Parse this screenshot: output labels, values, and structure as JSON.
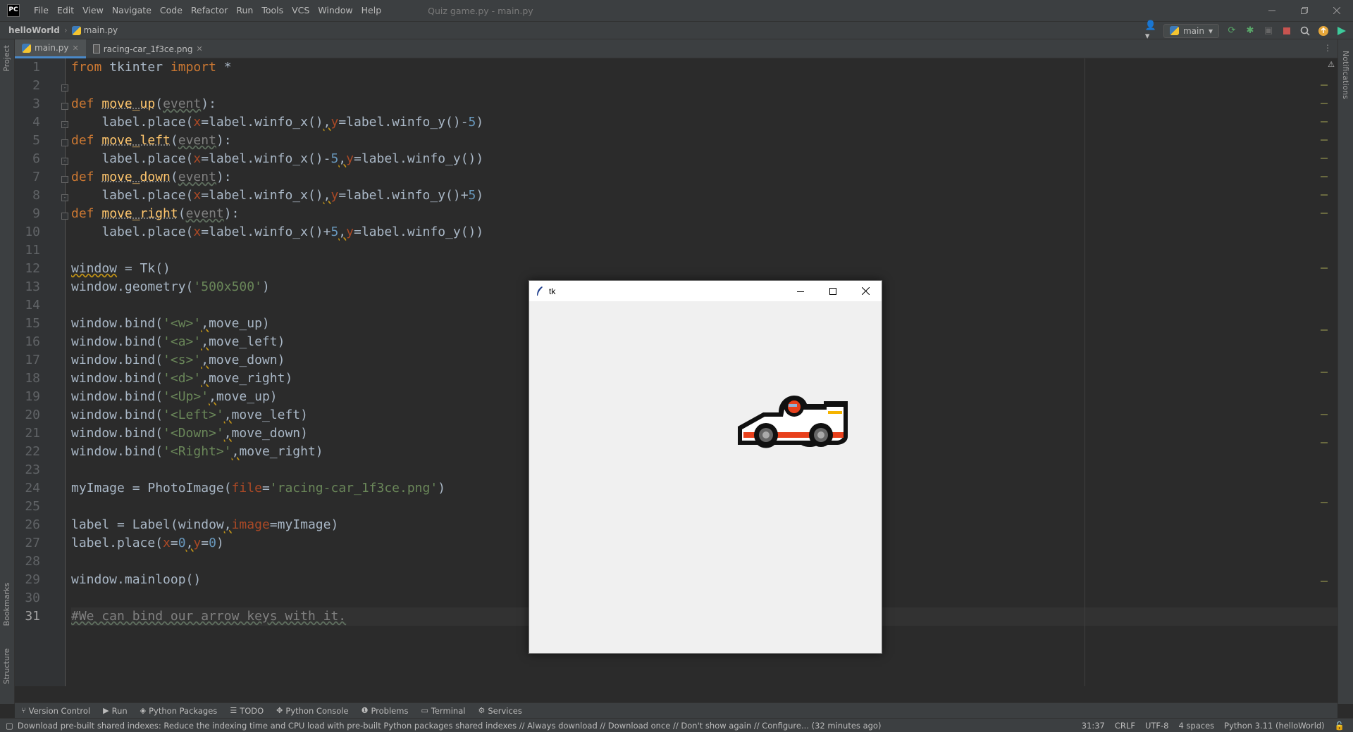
{
  "app": {
    "logo_text": "PC",
    "window_title": "Quiz game.py - main.py"
  },
  "menu": [
    "File",
    "Edit",
    "View",
    "Navigate",
    "Code",
    "Refactor",
    "Run",
    "Tools",
    "VCS",
    "Window",
    "Help"
  ],
  "breadcrumb": {
    "project": "helloWorld",
    "file": "main.py"
  },
  "toolbar": {
    "run_config": "main"
  },
  "tabs": [
    {
      "label": "main.py",
      "active": true
    },
    {
      "label": "racing-car_1f3ce.png",
      "active": false
    }
  ],
  "side_tabs": {
    "project": "Project",
    "bookmarks": "Bookmarks",
    "structure": "Structure",
    "notifications": "Notifications"
  },
  "editor": {
    "current_line": 31,
    "line_numbers": [
      "1",
      "2",
      "3",
      "4",
      "5",
      "6",
      "7",
      "8",
      "9",
      "10",
      "11",
      "12",
      "13",
      "14",
      "15",
      "16",
      "17",
      "18",
      "19",
      "20",
      "21",
      "22",
      "23",
      "24",
      "25",
      "26",
      "27",
      "28",
      "29",
      "30",
      "31"
    ]
  },
  "tk_window": {
    "title": "tk",
    "image": "racing-car_1f3ce.png"
  },
  "tool_windows": [
    {
      "label": "Version Control",
      "icon": "branch-icon"
    },
    {
      "label": "Run",
      "icon": "run-icon"
    },
    {
      "label": "Python Packages",
      "icon": "packages-icon"
    },
    {
      "label": "TODO",
      "icon": "todo-icon"
    },
    {
      "label": "Python Console",
      "icon": "python-console-icon"
    },
    {
      "label": "Problems",
      "icon": "problems-icon"
    },
    {
      "label": "Terminal",
      "icon": "terminal-icon"
    },
    {
      "label": "Services",
      "icon": "services-icon"
    }
  ],
  "status": {
    "message": "Download pre-built shared indexes: Reduce the indexing time and CPU load with pre-built Python packages shared indexes // Always download // Download once // Don't show again // Configure... (32 minutes ago)",
    "position": "31:37",
    "line_separator": "CRLF",
    "encoding": "UTF-8",
    "indent": "4 spaces",
    "interpreter": "Python 3.11 (helloWorld)"
  },
  "colors": {
    "keyword": "#cc7832",
    "function": "#ffc66d",
    "string": "#6a8759",
    "number": "#6897bb",
    "parameter": "#aa4926",
    "comment": "#808080",
    "default": "#a9b7c6",
    "accent": "#4a88c7"
  }
}
